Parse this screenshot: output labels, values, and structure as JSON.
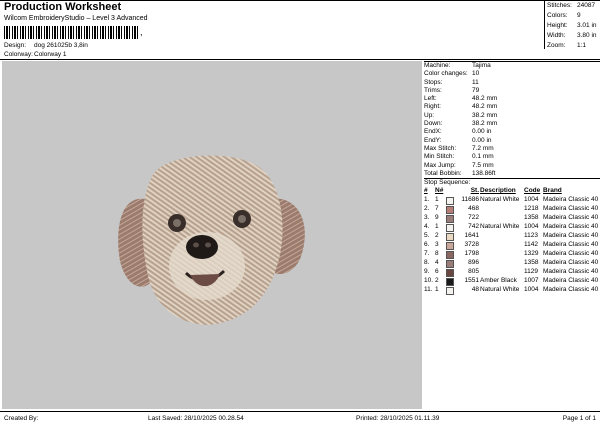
{
  "header": {
    "title": "Production Worksheet",
    "subtitle": "Wilcom EmbroideryStudio – Level 3 Advanced",
    "barcode_mark": ",",
    "design_label": "Design:",
    "design_value": "dog 261025b 3,8in",
    "colorway_label": "Colorway:",
    "colorway_value": "Colorway 1"
  },
  "stats": [
    {
      "label": "Stitches:",
      "value": "24087"
    },
    {
      "label": "Colors:",
      "value": "9"
    },
    {
      "label": "Height:",
      "value": "3.01 in"
    },
    {
      "label": "Width:",
      "value": "3.80 in"
    },
    {
      "label": "Zoom:",
      "value": "1:1"
    }
  ],
  "params": [
    {
      "label": "Machine:",
      "value": "Tajima"
    },
    {
      "label": "Color changes:",
      "value": "10"
    },
    {
      "label": "Stops:",
      "value": "11"
    },
    {
      "label": "Trims:",
      "value": "79"
    },
    {
      "label": "Left:",
      "value": "48.2 mm"
    },
    {
      "label": "Right:",
      "value": "48.2 mm"
    },
    {
      "label": "Up:",
      "value": "38.2 mm"
    },
    {
      "label": "Down:",
      "value": "38.2 mm"
    },
    {
      "label": "EndX:",
      "value": "0.00 in"
    },
    {
      "label": "EndY:",
      "value": "0.00 in"
    },
    {
      "label": "Max Stitch:",
      "value": "7.2 mm"
    },
    {
      "label": "Min Stitch:",
      "value": "0.1 mm"
    },
    {
      "label": "Max Jump:",
      "value": "7.5 mm"
    },
    {
      "label": "Total Bobbin:",
      "value": "138.86ft"
    }
  ],
  "sequence": {
    "title": "Stop Sequence:",
    "headers": {
      "num": "#",
      "n": "N#",
      "st": "St.",
      "desc": "Description",
      "code": "Code",
      "brand": "Brand"
    },
    "rows": [
      {
        "num": "1.",
        "n": "1",
        "color": "#f4f2ee",
        "st": "11686",
        "desc": "Natural White",
        "code": "1004",
        "brand": "Madeira Classic 40"
      },
      {
        "num": "2.",
        "n": "7",
        "color": "#b57f78",
        "st": "468",
        "desc": "",
        "code": "1218",
        "brand": "Madeira Classic 40"
      },
      {
        "num": "3.",
        "n": "9",
        "color": "#9a7d78",
        "st": "722",
        "desc": "",
        "code": "1358",
        "brand": "Madeira Classic 40"
      },
      {
        "num": "4.",
        "n": "1",
        "color": "#f4f2ee",
        "st": "742",
        "desc": "Natural White",
        "code": "1004",
        "brand": "Madeira Classic 40"
      },
      {
        "num": "5.",
        "n": "2",
        "color": "#ead9c2",
        "st": "1641",
        "desc": "",
        "code": "1123",
        "brand": "Madeira Classic 40"
      },
      {
        "num": "6.",
        "n": "3",
        "color": "#c8a79a",
        "st": "3728",
        "desc": "",
        "code": "1142",
        "brand": "Madeira Classic 40"
      },
      {
        "num": "7.",
        "n": "8",
        "color": "#8a6760",
        "st": "1798",
        "desc": "",
        "code": "1329",
        "brand": "Madeira Classic 40"
      },
      {
        "num": "8.",
        "n": "4",
        "color": "#9a7d78",
        "st": "896",
        "desc": "",
        "code": "1358",
        "brand": "Madeira Classic 40"
      },
      {
        "num": "9.",
        "n": "6",
        "color": "#6a4640",
        "st": "805",
        "desc": "",
        "code": "1129",
        "brand": "Madeira Classic 40"
      },
      {
        "num": "10.",
        "n": "2",
        "color": "#1a1a1a",
        "st": "1551",
        "desc": "Amber Black",
        "code": "1007",
        "brand": "Madeira Classic 40"
      },
      {
        "num": "11.",
        "n": "1",
        "color": "#f4f2ee",
        "st": "48",
        "desc": "Natural White",
        "code": "1004",
        "brand": "Madeira Classic 40"
      }
    ]
  },
  "footer": {
    "created_by": "Created By:",
    "last_saved": "Last Saved: 28/10/2025 00.28.54",
    "printed": "Printed: 28/10/2025 01.11.39",
    "page": "Page 1 of 1"
  },
  "design_image": {
    "subject": "embroidered dog face",
    "background": "#c7c7c7"
  }
}
